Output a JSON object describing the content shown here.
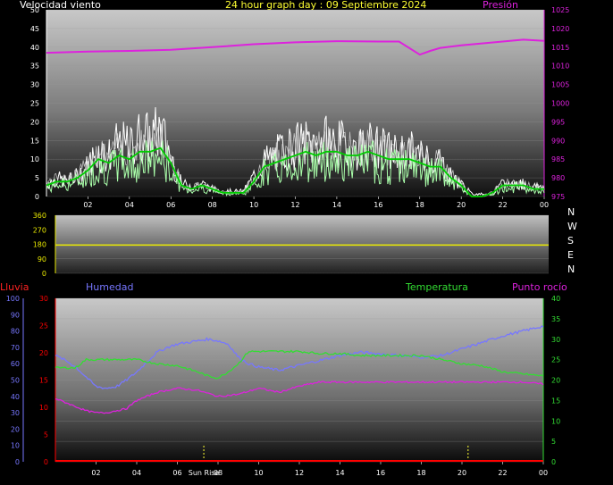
{
  "header": {
    "wind_label": "Velocidad viento",
    "title": "24 hour graph day : 09 Septiembre 2024",
    "pressure_label": "Presión"
  },
  "lower_labels": {
    "rain": "Lluvia",
    "humidity": "Humedad",
    "temperature": "Temperatura",
    "dewpoint": "Punto rocío"
  },
  "sun_labels": {
    "sunrise": "Sun Rise"
  },
  "compass": [
    "N",
    "W",
    "S",
    "E",
    "N"
  ],
  "colors": {
    "wind_gust": "#ffffff",
    "wind_avg": "#00cc00",
    "wind_light": "#aaffaa",
    "pressure": "#dd22dd",
    "direction": "#e8e800",
    "humidity": "#7777ff",
    "temperature": "#33dd33",
    "dewpoint": "#dd22dd",
    "rain": "#ff0000"
  },
  "chart_data": [
    {
      "type": "line",
      "x_unit": "hour",
      "x_ticks": [
        "02",
        "04",
        "06",
        "08",
        "10",
        "12",
        "14",
        "16",
        "18",
        "20",
        "22",
        "00"
      ],
      "y_left": {
        "ylim": [
          0,
          50
        ],
        "ticks": [
          "0",
          "5",
          "10",
          "15",
          "20",
          "25",
          "30",
          "35",
          "40",
          "45",
          "50"
        ]
      },
      "y_right": {
        "ylim": [
          975,
          1025
        ],
        "ticks": [
          "975",
          "980",
          "985",
          "990",
          "995",
          "1000",
          "1005",
          "1010",
          "1015",
          "1020",
          "1025"
        ]
      },
      "series": [
        {
          "name": "Velocidad viento",
          "axis": "left",
          "kind": "gust",
          "x": [
            0,
            0.5,
            1,
            1.5,
            2,
            2.5,
            3,
            3.5,
            4,
            4.5,
            5,
            5.5,
            6,
            6.5,
            7,
            7.5,
            8,
            8.5,
            9,
            9.5,
            10,
            10.5,
            11,
            11.5,
            12,
            12.5,
            13,
            13.5,
            14,
            14.5,
            15,
            15.5,
            16,
            16.5,
            17,
            17.5,
            18,
            18.5,
            19,
            19.5,
            20,
            20.5,
            21,
            21.5,
            22,
            22.5,
            23,
            23.5,
            24
          ],
          "y": [
            5,
            7,
            6,
            8,
            12,
            18,
            16,
            21,
            19,
            24,
            23,
            26,
            16,
            5,
            4,
            5,
            3,
            2,
            2,
            2,
            8,
            14,
            16,
            19,
            20,
            21,
            20,
            22,
            21,
            20,
            19,
            21,
            19,
            18,
            17,
            18,
            16,
            15,
            14,
            8,
            5,
            1,
            1,
            1,
            5,
            5,
            5,
            4,
            4
          ]
        },
        {
          "name": "Velocidad viento",
          "axis": "left",
          "kind": "average",
          "x": [
            0,
            0.5,
            1,
            1.5,
            2,
            2.5,
            3,
            3.5,
            4,
            4.5,
            5,
            5.5,
            6,
            6.5,
            7,
            7.5,
            8,
            8.5,
            9,
            9.5,
            10,
            10.5,
            11,
            11.5,
            12,
            12.5,
            13,
            13.5,
            14,
            14.5,
            15,
            15.5,
            16,
            16.5,
            17,
            17.5,
            18,
            18.5,
            19,
            19.5,
            20,
            20.5,
            21,
            21.5,
            22,
            22.5,
            23,
            23.5,
            24
          ],
          "y": [
            3,
            4,
            4,
            5,
            7,
            10,
            9,
            11,
            10,
            12,
            12,
            13,
            9,
            3,
            2,
            3,
            2,
            1,
            1,
            1,
            4,
            8,
            9,
            10,
            11,
            12,
            11,
            12,
            12,
            11,
            11,
            12,
            11,
            10,
            10,
            10,
            9,
            8,
            8,
            5,
            3,
            0,
            0,
            1,
            3,
            3,
            3,
            2,
            2
          ]
        },
        {
          "name": "Presión",
          "axis": "right",
          "x": [
            0,
            2,
            4,
            6,
            8,
            10,
            12,
            14,
            16,
            17,
            18,
            18.5,
            19,
            20,
            22,
            23,
            24
          ],
          "y": [
            1013.5,
            1013.8,
            1014,
            1014.3,
            1015,
            1015.8,
            1016.3,
            1016.6,
            1016.5,
            1016.5,
            1013,
            1014,
            1014.8,
            1015.5,
            1016.5,
            1017,
            1016.7
          ]
        }
      ]
    },
    {
      "type": "line",
      "x_unit": "hour",
      "y_left": {
        "ylim": [
          0,
          360
        ],
        "ticks": [
          "0",
          "90",
          "180",
          "270",
          "360"
        ]
      },
      "series": [
        {
          "name": "Dirección",
          "x": [
            0,
            24
          ],
          "y": [
            175,
            175
          ]
        }
      ]
    },
    {
      "type": "line",
      "x_unit": "hour",
      "x_ticks": [
        "02",
        "04",
        "06",
        "08",
        "10",
        "12",
        "14",
        "16",
        "18",
        "20",
        "22",
        "00"
      ],
      "y_left_outer": {
        "name": "Humedad",
        "ylim": [
          0,
          100
        ],
        "ticks": [
          "0",
          "10",
          "20",
          "30",
          "40",
          "50",
          "60",
          "70",
          "80",
          "90",
          "100"
        ]
      },
      "y_left_inner": {
        "name": "Lluvia",
        "ylim": [
          0,
          30
        ],
        "ticks": [
          "0",
          "5",
          "10",
          "15",
          "20",
          "25",
          "30"
        ]
      },
      "y_right": {
        "name": "Temperatura",
        "ylim": [
          0,
          40
        ],
        "ticks": [
          "0",
          "5",
          "10",
          "15",
          "20",
          "25",
          "30",
          "35",
          "40"
        ]
      },
      "sunrise_hour": 7.3,
      "sunset_hour": 20.3,
      "series": [
        {
          "name": "Humedad",
          "axis": "outer",
          "x": [
            0,
            0.5,
            1,
            1.5,
            2,
            2.5,
            3,
            3.5,
            4,
            4.5,
            5,
            5.5,
            6,
            6.5,
            7,
            7.5,
            8,
            8.5,
            9,
            9.5,
            10,
            11,
            12,
            13,
            14,
            15,
            16,
            17,
            18,
            19,
            20,
            21,
            22,
            23,
            24
          ],
          "y": [
            65,
            62,
            58,
            52,
            46,
            45,
            46,
            50,
            55,
            61,
            67,
            70,
            72,
            73,
            74,
            75,
            74,
            72,
            64,
            60,
            58,
            56,
            59,
            62,
            65,
            67,
            66,
            65,
            64,
            65,
            69,
            73,
            77,
            80,
            83
          ]
        },
        {
          "name": "Temperatura",
          "axis": "right",
          "x": [
            0,
            1,
            1.5,
            2,
            3,
            4,
            5,
            6,
            7,
            7.5,
            8,
            8.5,
            9,
            9.5,
            10,
            11,
            12,
            13,
            14,
            15,
            16,
            17,
            18,
            19,
            20,
            21,
            22,
            23,
            24
          ],
          "y": [
            23,
            23,
            25,
            25,
            25,
            25,
            24,
            23.5,
            22,
            21,
            20.5,
            22,
            24,
            27,
            27,
            27,
            27,
            26.5,
            26.5,
            26,
            26,
            26,
            26,
            25,
            24,
            23.5,
            22,
            21.5,
            21
          ]
        },
        {
          "name": "Punto rocío",
          "axis": "right",
          "x": [
            0,
            0.5,
            1,
            1.5,
            2,
            2.5,
            3,
            3.5,
            4,
            5,
            6,
            7,
            8,
            9,
            10,
            11,
            12,
            13,
            14,
            15,
            16,
            17,
            18,
            19,
            20,
            21,
            22,
            23,
            24
          ],
          "y": [
            15.5,
            14.5,
            13.5,
            12.5,
            12,
            12,
            12.5,
            13,
            15,
            17,
            18,
            17.5,
            16,
            16.5,
            18,
            17,
            18.5,
            19.5,
            19.5,
            19.5,
            19.5,
            19.5,
            19.5,
            19.5,
            19.5,
            19.5,
            19.5,
            19.5,
            19
          ]
        },
        {
          "name": "Lluvia",
          "axis": "inner",
          "x": [
            0,
            24
          ],
          "y": [
            0,
            0
          ]
        }
      ]
    }
  ]
}
